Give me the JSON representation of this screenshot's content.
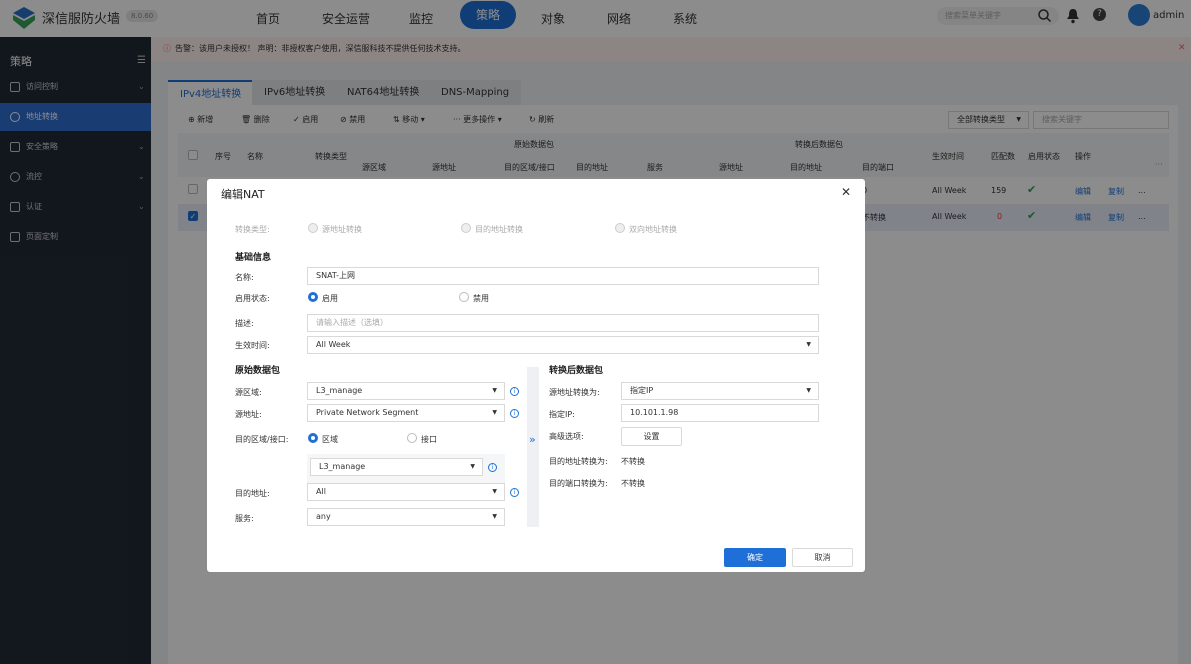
{
  "app": {
    "brand": "深信服防火墙",
    "version": "8.0.60",
    "user": "admin",
    "search_placeholder": "搜索菜单关键字"
  },
  "nav": [
    "首页",
    "安全运营",
    "监控",
    "策略",
    "对象",
    "网络",
    "系统"
  ],
  "sidebar": {
    "title": "策略",
    "items": [
      {
        "label": "访问控制",
        "chevron": true
      },
      {
        "label": "地址转换",
        "chevron": false,
        "active": true
      },
      {
        "label": "安全策略",
        "chevron": true
      },
      {
        "label": "流控",
        "chevron": true
      },
      {
        "label": "认证",
        "chevron": true
      },
      {
        "label": "页面定制",
        "chevron": false
      }
    ]
  },
  "warning": "告警：该用户未授权！   声明：非授权客户使用，深信服科技不提供任何技术支持。",
  "tabs": [
    "IPv4地址转换",
    "IPv6地址转换",
    "NAT64地址转换",
    "DNS-Mapping"
  ],
  "toolbar": {
    "add": "新增",
    "delete": "删除",
    "enable": "启用",
    "disable": "禁用",
    "move": "移动",
    "more": "更多操作",
    "refresh": "刷新",
    "filter": "全部转换类型",
    "search_placeholder": "搜索关键字"
  },
  "table": {
    "group_orig": "原始数据包",
    "group_trans": "转换后数据包",
    "headers": [
      "序号",
      "名称",
      "转换类型",
      "源区域",
      "源地址",
      "目的区域/接口",
      "目的地址",
      "服务",
      "源地址",
      "目的地址",
      "目的端口",
      "生效时间",
      "匹配数",
      "启用状态",
      "操作"
    ],
    "rows": [
      {
        "port_tail": "0",
        "time": "All Week",
        "count": "159",
        "edit": "编辑",
        "copy": "复制",
        "more": "..."
      },
      {
        "port_tail": "不转换",
        "time": "All Week",
        "count": "0",
        "edit": "编辑",
        "copy": "复制",
        "more": "..."
      }
    ]
  },
  "modal": {
    "title": "编辑NAT",
    "type_label": "转换类型:",
    "types": [
      "源地址转换",
      "目的地址转换",
      "双向地址转换"
    ],
    "basic_title": "基础信息",
    "name_label": "名称:",
    "name_value": "SNAT-上网",
    "status_label": "启用状态:",
    "status_on": "启用",
    "status_off": "禁用",
    "desc_label": "描述:",
    "desc_placeholder": "请输入描述（选填）",
    "time_label": "生效时间:",
    "time_value": "All Week",
    "orig_title": "原始数据包",
    "src_zone_label": "源区域:",
    "src_zone_value": "L3_manage",
    "src_addr_label": "源地址:",
    "src_addr_value": "Private Network Segment",
    "dst_zone_label": "目的区域/接口:",
    "dst_opt_zone": "区域",
    "dst_opt_if": "接口",
    "dst_zone_value": "L3_manage",
    "dst_addr_label": "目的地址:",
    "dst_addr_value": "All",
    "service_label": "服务:",
    "service_value": "any",
    "trans_title": "转换后数据包",
    "src_trans_label": "源地址转换为:",
    "src_trans_value": "指定IP",
    "ip_label": "指定IP:",
    "ip_value": "10.101.1.98",
    "adv_label": "高级选项:",
    "adv_button": "设置",
    "dst_trans_label": "目的地址转换为:",
    "dst_trans_value": "不转换",
    "port_trans_label": "目的端口转换为:",
    "port_trans_value": "不转换",
    "ok": "确定",
    "cancel": "取消"
  }
}
